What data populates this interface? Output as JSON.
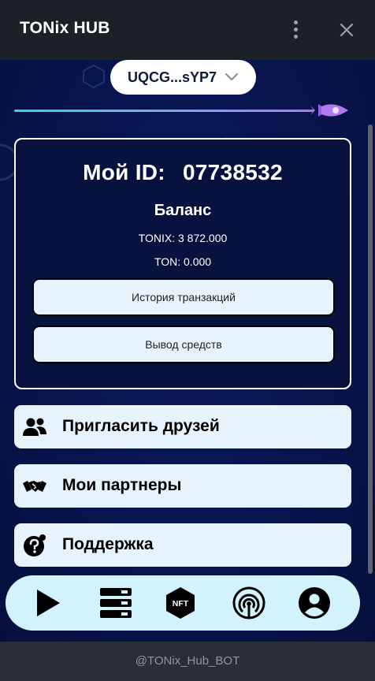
{
  "titlebar": {
    "title": "TONix HUB",
    "menu_icon": "more-vertical-icon",
    "close_icon": "close-icon"
  },
  "wallet": {
    "address": "UQCG...sYP7",
    "icon": "chevron-down-icon"
  },
  "progress": {
    "fraction": 0.9,
    "icon": "rocket-icon"
  },
  "card": {
    "id_label": "Мой ID:",
    "id_value": "07738532",
    "balance_title": "Баланс",
    "tonix_balance": "TONIX: 3 872.000",
    "ton_balance": "TON: 0.000",
    "history_button": "История транзакций",
    "withdraw_button": "Вывод средств"
  },
  "menu": [
    {
      "label": "Пригласить друзей",
      "icon": "users-icon"
    },
    {
      "label": "Мои партнеры",
      "icon": "handshake-icon"
    },
    {
      "label": "Поддержка",
      "icon": "support-icon"
    }
  ],
  "bottom_nav": [
    {
      "icon": "play-icon"
    },
    {
      "icon": "server-stack-icon"
    },
    {
      "icon": "nft-icon",
      "text": "NFT"
    },
    {
      "icon": "broadcast-icon"
    },
    {
      "icon": "profile-icon"
    }
  ],
  "footer": {
    "bot_name": "@TONix_Hub_BOT"
  },
  "colors": {
    "app_bg": "#081550",
    "button_bg": "#e6f2fc",
    "nav_bg": "#d2f2fc",
    "accent_cyan": "#34d6e0",
    "accent_purple": "#b178f0"
  }
}
